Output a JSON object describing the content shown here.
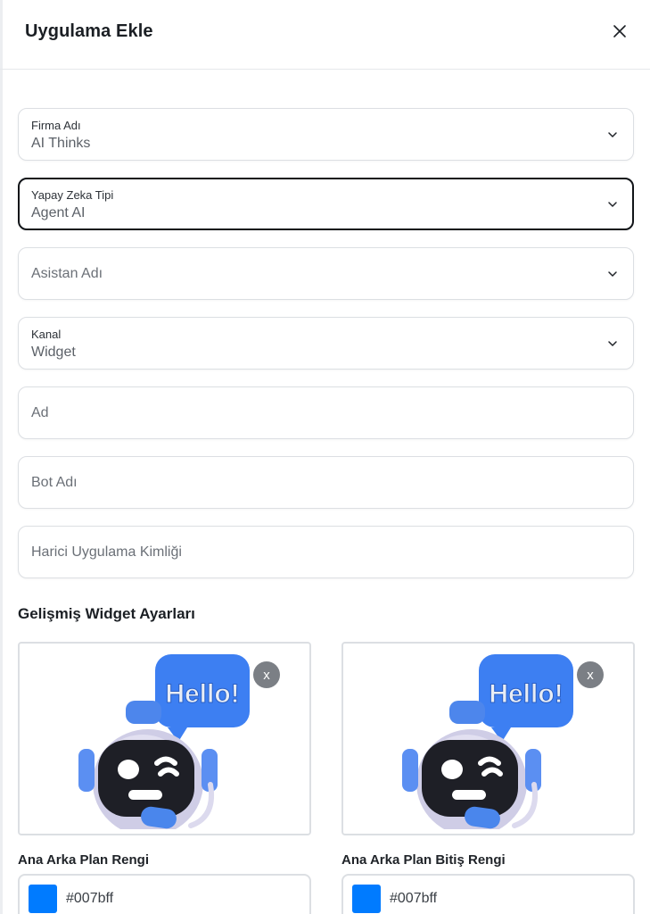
{
  "header": {
    "title": "Uygulama Ekle",
    "close_icon": "close-icon"
  },
  "fields": {
    "firma": {
      "label": "Firma Adı",
      "value": "AI Thinks"
    },
    "yapay_zeka": {
      "label": "Yapay Zeka Tipi",
      "value": "Agent AI"
    },
    "asistan": {
      "placeholder": "Asistan Adı"
    },
    "kanal": {
      "label": "Kanal",
      "value": "Widget"
    },
    "ad": {
      "placeholder": "Ad"
    },
    "bot_adi": {
      "placeholder": "Bot Adı"
    },
    "harici": {
      "placeholder": "Harici Uygulama Kimliği"
    }
  },
  "advanced": {
    "title": "Gelişmiş Widget Ayarları",
    "images": [
      {
        "bubble_text": "Hello!",
        "remove_label": "x"
      },
      {
        "bubble_text": "Hello!",
        "remove_label": "x"
      }
    ],
    "colors": [
      {
        "label": "Ana Arka Plan Rengi",
        "value": "#007bff",
        "swatch": "#007bff"
      },
      {
        "label": "Ana Arka Plan Bitiş Rengi",
        "value": "#007bff",
        "swatch": "#007bff"
      }
    ]
  }
}
